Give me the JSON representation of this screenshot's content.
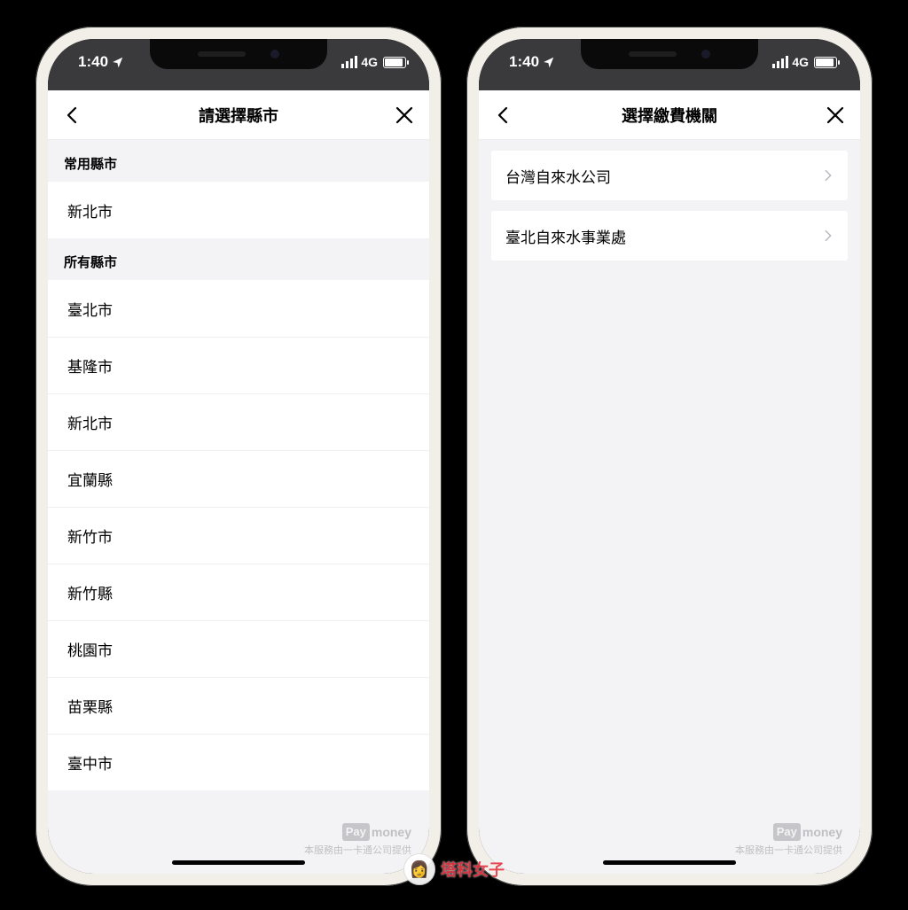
{
  "status": {
    "time": "1:40",
    "network": "4G"
  },
  "phone1": {
    "title": "請選擇縣市",
    "section_frequent": "常用縣市",
    "frequent": [
      "新北市"
    ],
    "section_all": "所有縣市",
    "all": [
      "臺北市",
      "基隆市",
      "新北市",
      "宜蘭縣",
      "新竹市",
      "新竹縣",
      "桃園市",
      "苗栗縣",
      "臺中市"
    ]
  },
  "phone2": {
    "title": "選擇繳費機關",
    "options": [
      "台灣自來水公司",
      "臺北自來水事業處"
    ]
  },
  "footer": {
    "brand_pay": "Pay",
    "brand_money": "money",
    "note": "本服務由一卡通公司提供"
  },
  "watermark": "塔科女子"
}
